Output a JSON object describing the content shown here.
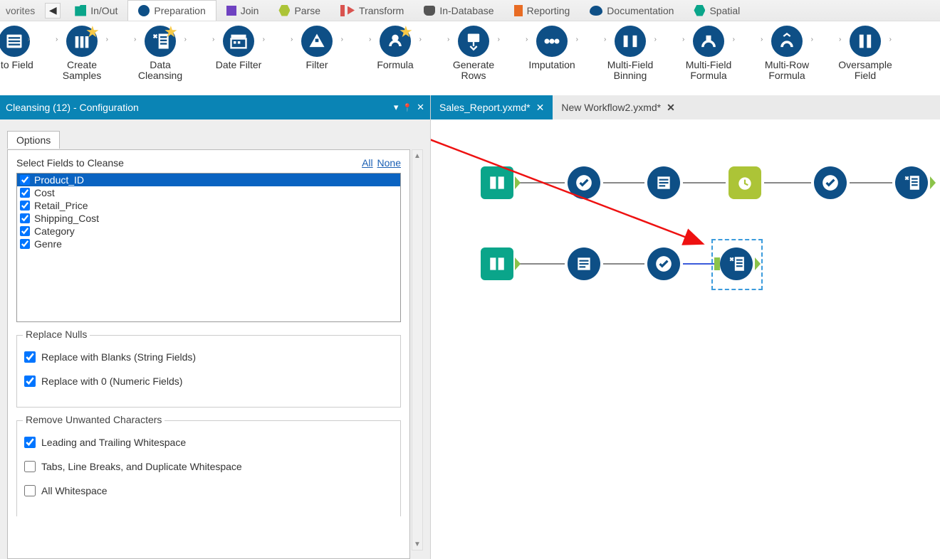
{
  "favorites_label": "vorites",
  "categories": [
    {
      "label": "In/Out"
    },
    {
      "label": "Preparation"
    },
    {
      "label": "Join"
    },
    {
      "label": "Parse"
    },
    {
      "label": "Transform"
    },
    {
      "label": "In-Database"
    },
    {
      "label": "Reporting"
    },
    {
      "label": "Documentation"
    },
    {
      "label": "Spatial"
    }
  ],
  "tools": [
    {
      "label": "uto Field",
      "star": false
    },
    {
      "label": "Create\nSamples",
      "star": true
    },
    {
      "label": "Data\nCleansing",
      "star": true
    },
    {
      "label": "Date Filter",
      "star": false
    },
    {
      "label": "Filter",
      "star": false
    },
    {
      "label": "Formula",
      "star": true
    },
    {
      "label": "Generate\nRows",
      "star": false
    },
    {
      "label": "Imputation",
      "star": false
    },
    {
      "label": "Multi-Field\nBinning",
      "star": false
    },
    {
      "label": "Multi-Field\nFormula",
      "star": false
    },
    {
      "label": "Multi-Row\nFormula",
      "star": false
    },
    {
      "label": "Oversample\nField",
      "star": false
    }
  ],
  "config_title": "Cleansing (12) - Configuration",
  "canvas_tabs": [
    {
      "label": "Sales_Report.yxmd*"
    },
    {
      "label": "New Workflow2.yxmd*"
    }
  ],
  "options_tab": "Options",
  "fields_header": "Select Fields to Cleanse",
  "link_all": "All",
  "link_none": "None",
  "fields": [
    "Product_ID",
    "Cost",
    "Retail_Price",
    "Shipping_Cost",
    "Category",
    "Genre"
  ],
  "replace_nulls_title": "Replace Nulls",
  "replace_nulls": [
    {
      "label": "Replace with Blanks (String Fields)",
      "checked": true
    },
    {
      "label": "Replace with 0 (Numeric Fields)",
      "checked": true
    }
  ],
  "remove_title": "Remove Unwanted Characters",
  "remove": [
    {
      "label": "Leading and Trailing Whitespace",
      "checked": true
    },
    {
      "label": "Tabs, Line Breaks, and Duplicate Whitespace",
      "checked": false
    },
    {
      "label": "All Whitespace",
      "checked": false
    }
  ],
  "icons": {
    "dropdown": "▾",
    "pin": "📌",
    "close": "✕",
    "arrow_left": "◀",
    "scroll_up": "▲",
    "scroll_down": "▼"
  }
}
